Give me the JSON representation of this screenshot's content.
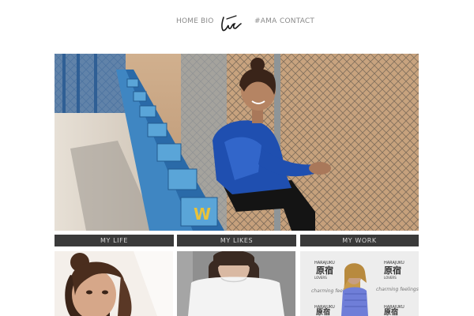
{
  "nav": {
    "items": [
      "HOME",
      "BIO",
      "#AMA",
      "CONTACT"
    ],
    "logo_text": "liz"
  },
  "sections": [
    {
      "label": "MY LIFE"
    },
    {
      "label": "MY LIKES"
    },
    {
      "label": "MY WORK"
    }
  ],
  "thumb3": {
    "brand_chinese": "原宿",
    "brand_top": "HARAJUKU",
    "brand_bottom": "LOVERS",
    "tagline": "charming feelings"
  },
  "colors": {
    "background": "#ffffff",
    "nav_text": "#8a8a8a",
    "tab_bg": "#3a3a3a",
    "tab_text": "#d8d8d8"
  }
}
